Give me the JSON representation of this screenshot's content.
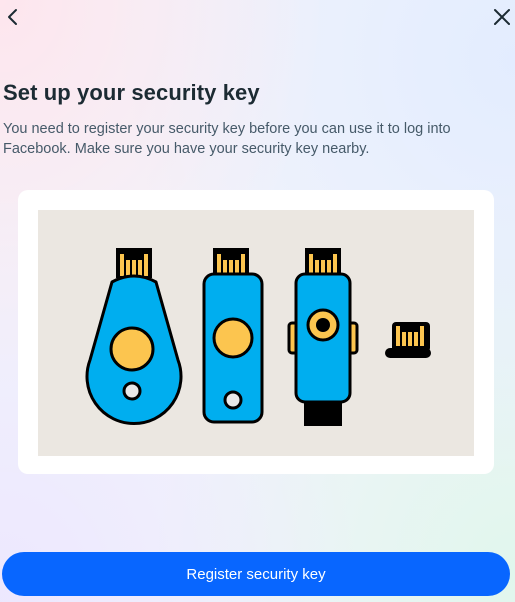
{
  "header": {
    "back_icon": "chevron-left-icon",
    "close_icon": "close-icon"
  },
  "main": {
    "title": "Set up your security key",
    "description": "You need to register your security key before you can use it to log into Facebook. Make sure you have your security key nearby."
  },
  "illustration": {
    "keys": [
      "teardrop-security-key",
      "rectangular-security-key",
      "usb-security-key",
      "nano-security-key"
    ],
    "colors": {
      "key_body": "#00aeef",
      "contact": "#fcc54f",
      "outline": "#000000",
      "background": "#ebe7e1"
    }
  },
  "footer": {
    "register_label": "Register security key"
  },
  "colors": {
    "accent": "#0866ff",
    "title": "#1c2b33",
    "body_text": "#465a69"
  }
}
